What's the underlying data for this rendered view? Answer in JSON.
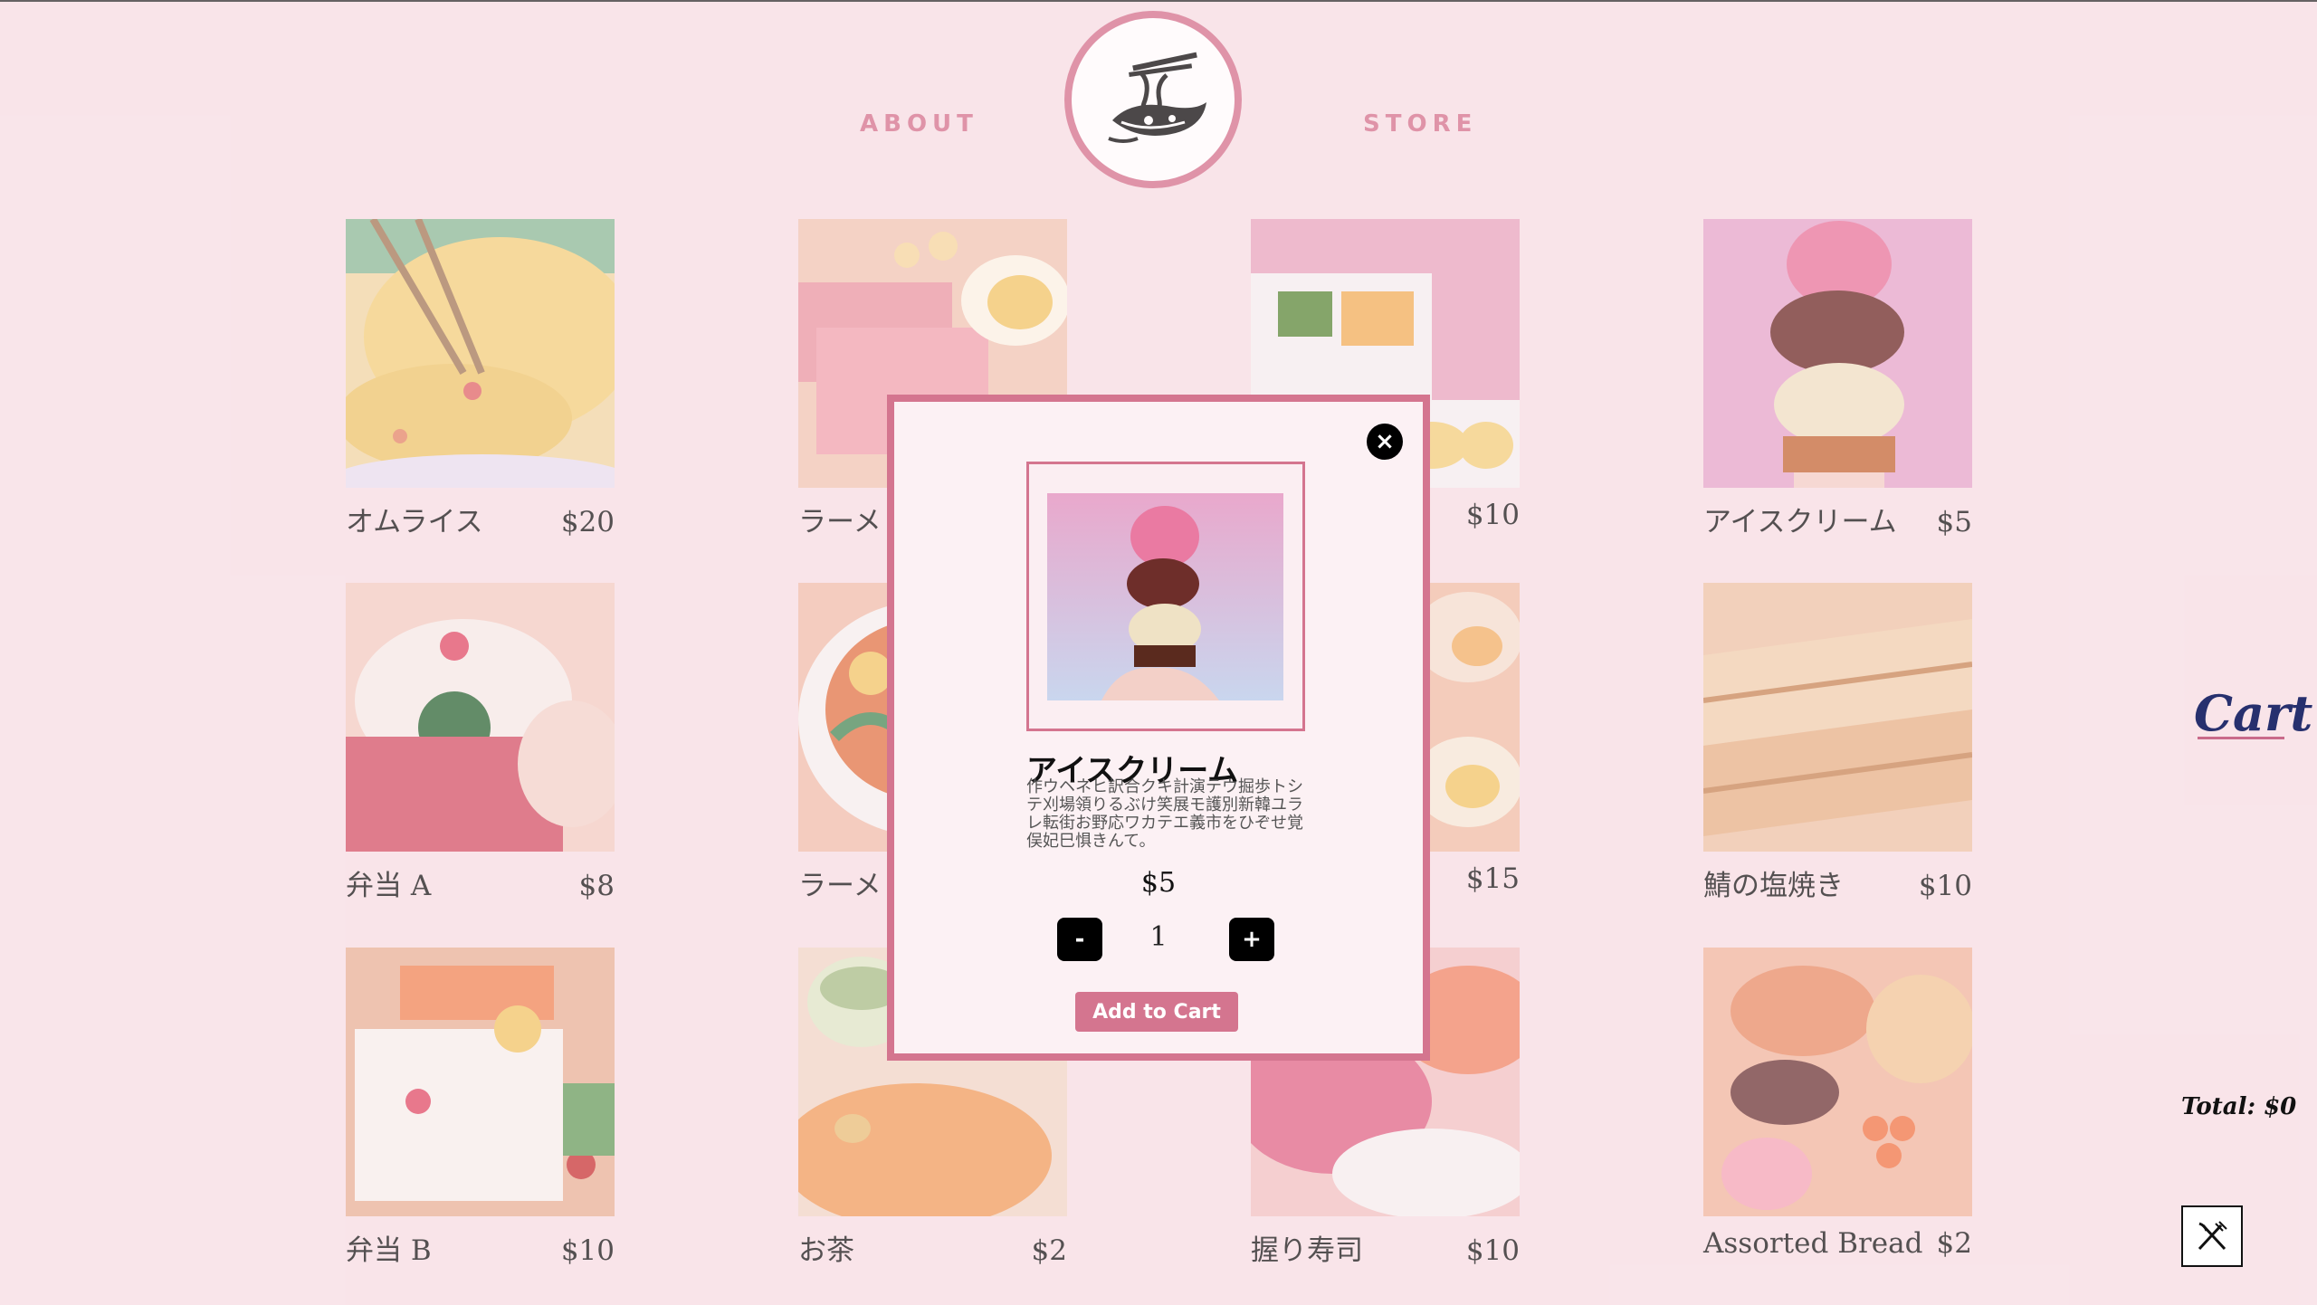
{
  "nav": {
    "about": "ABOUT",
    "store": "STORE"
  },
  "colors": {
    "background": "#f7e1e6",
    "accent": "#d4758f",
    "cart_text": "#27306e"
  },
  "products": [
    {
      "name": "オムライス",
      "price": "$20"
    },
    {
      "name": "ラーメ",
      "price": ""
    },
    {
      "name": "",
      "price": "$10"
    },
    {
      "name": "アイスクリーム",
      "price": "$5"
    },
    {
      "name": "弁当 A",
      "price": "$8"
    },
    {
      "name": "ラーメ",
      "price": ""
    },
    {
      "name": "",
      "price": "$15"
    },
    {
      "name": "鯖の塩焼き",
      "price": "$10"
    },
    {
      "name": "弁当 B",
      "price": "$10"
    },
    {
      "name": "お茶",
      "price": "$2"
    },
    {
      "name": "握り寿司",
      "price": "$10"
    },
    {
      "name": "Assorted Bread",
      "price": "$2"
    }
  ],
  "modal": {
    "close_icon": "×",
    "title": "アイスクリーム",
    "description": "作ウヘネヒ訳合クキ計演テウ掘歩トシテ刈場領りるぶけ笑展モ護別新韓ユラレ転街お野応ワカテエ義市をひぞせ覚俣妃巳惧きんて。",
    "price": "$5",
    "minus_label": "-",
    "plus_label": "+",
    "quantity": "1",
    "add_to_cart": "Add to Cart"
  },
  "cart": {
    "label": "Cart",
    "total": "Total: $0",
    "icon": "cutlery-icon"
  }
}
